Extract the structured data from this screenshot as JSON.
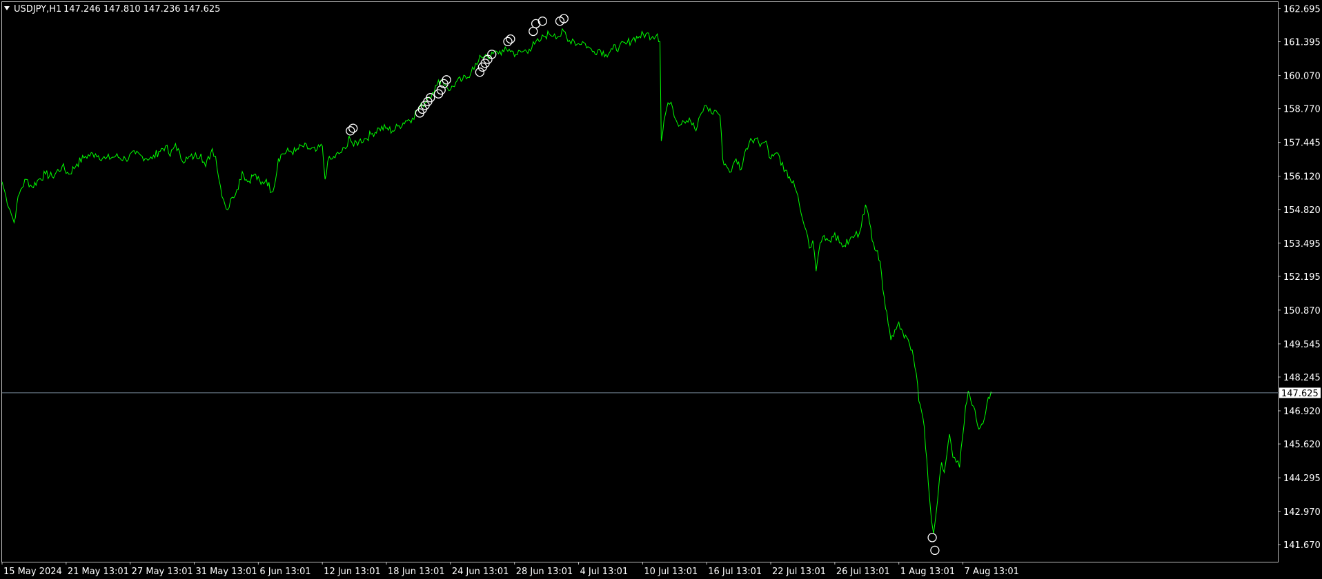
{
  "header": {
    "menu_icon": "triangle-down-icon",
    "symbol": "USDJPY,H1",
    "ohlc": "147.246 147.810 147.236 147.625"
  },
  "colors": {
    "background": "#000000",
    "price_line": "#00ff00",
    "frame": "#c0c0c0",
    "bid_line": "#778899",
    "marker": "#ffffff",
    "text": "#ffffff"
  },
  "current_price": {
    "value": 147.625,
    "label": "147.625"
  },
  "chart_data": {
    "type": "line",
    "title": "USDJPY,H1",
    "ylim": [
      141.0,
      162.95
    ],
    "grid": false,
    "y_ticks": [
      "162.695",
      "161.395",
      "160.070",
      "158.770",
      "157.445",
      "156.120",
      "154.820",
      "153.495",
      "152.195",
      "150.870",
      "149.545",
      "148.245",
      "146.920",
      "145.620",
      "144.295",
      "142.970",
      "141.670"
    ],
    "x_ticks": [
      "15 May 2024",
      "21 May 13:01",
      "27 May 13:01",
      "31 May 13:01",
      "6 Jun 13:01",
      "12 Jun 13:01",
      "18 Jun 13:01",
      "24 Jun 13:01",
      "28 Jun 13:01",
      "4 Jul 13:01",
      "10 Jul 13:01",
      "16 Jul 13:01",
      "22 Jul 13:01",
      "26 Jul 13:01",
      "1 Aug 13:01",
      "7 Aug 13:01"
    ],
    "x_tick_bars": [
      0,
      96,
      192,
      288,
      384,
      480,
      576,
      672,
      768,
      864,
      960,
      1056,
      1152,
      1248,
      1344,
      1440
    ],
    "x_range_bars": [
      0,
      1912
    ],
    "series": [
      {
        "values": [
          [
            0,
            155.9
          ],
          [
            6,
            155.3
          ],
          [
            12,
            154.8
          ],
          [
            18,
            154.3
          ],
          [
            22,
            155.0
          ],
          [
            28,
            155.6
          ],
          [
            36,
            156.0
          ],
          [
            45,
            155.7
          ],
          [
            55,
            156.0
          ],
          [
            65,
            156.2
          ],
          [
            75,
            156.1
          ],
          [
            90,
            156.5
          ],
          [
            100,
            156.2
          ],
          [
            112,
            156.6
          ],
          [
            125,
            156.9
          ],
          [
            140,
            157.0
          ],
          [
            155,
            156.8
          ],
          [
            170,
            156.9
          ],
          [
            185,
            156.8
          ],
          [
            200,
            157.0
          ],
          [
            210,
            156.9
          ],
          [
            225,
            156.8
          ],
          [
            235,
            157.1
          ],
          [
            245,
            157.3
          ],
          [
            252,
            156.9
          ],
          [
            260,
            157.4
          ],
          [
            268,
            156.8
          ],
          [
            278,
            156.8
          ],
          [
            288,
            156.9
          ],
          [
            298,
            157.0
          ],
          [
            305,
            156.5
          ],
          [
            315,
            157.2
          ],
          [
            320,
            156.9
          ],
          [
            325,
            156.0
          ],
          [
            332,
            155.2
          ],
          [
            338,
            154.8
          ],
          [
            345,
            155.3
          ],
          [
            352,
            155.6
          ],
          [
            360,
            156.3
          ],
          [
            368,
            155.9
          ],
          [
            378,
            156.2
          ],
          [
            388,
            155.8
          ],
          [
            396,
            156.0
          ],
          [
            404,
            155.5
          ],
          [
            410,
            156.0
          ],
          [
            414,
            156.8
          ],
          [
            420,
            157.0
          ],
          [
            430,
            157.1
          ],
          [
            440,
            157.1
          ],
          [
            450,
            157.3
          ],
          [
            460,
            157.2
          ],
          [
            470,
            157.1
          ],
          [
            480,
            157.3
          ],
          [
            484,
            156.0
          ],
          [
            488,
            156.7
          ],
          [
            495,
            156.8
          ],
          [
            505,
            157.0
          ],
          [
            515,
            157.2
          ],
          [
            520,
            157.7
          ],
          [
            527,
            157.3
          ],
          [
            535,
            157.5
          ],
          [
            545,
            157.6
          ],
          [
            555,
            157.8
          ],
          [
            565,
            158.0
          ],
          [
            575,
            158.0
          ],
          [
            585,
            157.9
          ],
          [
            595,
            158.1
          ],
          [
            605,
            158.3
          ],
          [
            615,
            158.4
          ],
          [
            622,
            158.7
          ],
          [
            630,
            158.9
          ],
          [
            638,
            159.2
          ],
          [
            645,
            159.4
          ],
          [
            652,
            159.7
          ],
          [
            658,
            159.9
          ],
          [
            665,
            159.7
          ],
          [
            672,
            159.5
          ],
          [
            680,
            159.8
          ],
          [
            690,
            159.9
          ],
          [
            698,
            160.0
          ],
          [
            705,
            160.4
          ],
          [
            712,
            160.5
          ],
          [
            718,
            160.8
          ],
          [
            725,
            160.9
          ],
          [
            732,
            160.8
          ],
          [
            742,
            161.0
          ],
          [
            752,
            161.0
          ],
          [
            760,
            161.1
          ],
          [
            770,
            160.9
          ],
          [
            780,
            161.0
          ],
          [
            790,
            161.1
          ],
          [
            798,
            161.3
          ],
          [
            805,
            161.4
          ],
          [
            812,
            161.6
          ],
          [
            820,
            161.7
          ],
          [
            828,
            161.7
          ],
          [
            835,
            161.6
          ],
          [
            842,
            161.8
          ],
          [
            848,
            161.4
          ],
          [
            855,
            161.5
          ],
          [
            862,
            161.3
          ],
          [
            870,
            161.4
          ],
          [
            878,
            161.2
          ],
          [
            885,
            161.0
          ],
          [
            895,
            161.1
          ],
          [
            905,
            160.9
          ],
          [
            915,
            161.1
          ],
          [
            925,
            161.2
          ],
          [
            935,
            161.3
          ],
          [
            945,
            161.5
          ],
          [
            955,
            161.6
          ],
          [
            965,
            161.7
          ],
          [
            975,
            161.6
          ],
          [
            982,
            161.7
          ],
          [
            986,
            161.4
          ],
          [
            988,
            157.5
          ],
          [
            992,
            158.3
          ],
          [
            998,
            159.0
          ],
          [
            1005,
            158.8
          ],
          [
            1012,
            158.2
          ],
          [
            1020,
            158.3
          ],
          [
            1030,
            158.4
          ],
          [
            1040,
            157.9
          ],
          [
            1048,
            158.6
          ],
          [
            1055,
            158.9
          ],
          [
            1063,
            158.6
          ],
          [
            1070,
            158.7
          ],
          [
            1076,
            158.5
          ],
          [
            1080,
            156.8
          ],
          [
            1086,
            156.5
          ],
          [
            1093,
            156.3
          ],
          [
            1100,
            156.8
          ],
          [
            1108,
            156.4
          ],
          [
            1115,
            157.2
          ],
          [
            1122,
            157.6
          ],
          [
            1130,
            157.6
          ],
          [
            1138,
            157.4
          ],
          [
            1145,
            157.5
          ],
          [
            1152,
            156.8
          ],
          [
            1158,
            157.0
          ],
          [
            1165,
            156.9
          ],
          [
            1172,
            156.3
          ],
          [
            1180,
            156.1
          ],
          [
            1188,
            155.7
          ],
          [
            1195,
            155.0
          ],
          [
            1200,
            154.4
          ],
          [
            1205,
            154.0
          ],
          [
            1210,
            153.3
          ],
          [
            1215,
            153.6
          ],
          [
            1220,
            152.4
          ],
          [
            1226,
            153.5
          ],
          [
            1232,
            153.8
          ],
          [
            1240,
            153.6
          ],
          [
            1248,
            153.9
          ],
          [
            1255,
            153.5
          ],
          [
            1262,
            153.4
          ],
          [
            1270,
            153.6
          ],
          [
            1278,
            153.8
          ],
          [
            1285,
            153.9
          ],
          [
            1290,
            154.6
          ],
          [
            1294,
            155.0
          ],
          [
            1300,
            154.3
          ],
          [
            1306,
            153.5
          ],
          [
            1312,
            153.2
          ],
          [
            1318,
            152.3
          ],
          [
            1322,
            151.4
          ],
          [
            1326,
            150.8
          ],
          [
            1332,
            149.7
          ],
          [
            1338,
            150.1
          ],
          [
            1344,
            150.4
          ],
          [
            1350,
            150.0
          ],
          [
            1356,
            149.8
          ],
          [
            1362,
            149.3
          ],
          [
            1366,
            149.0
          ],
          [
            1370,
            148.4
          ],
          [
            1374,
            147.3
          ],
          [
            1378,
            146.9
          ],
          [
            1382,
            146.3
          ],
          [
            1386,
            145.0
          ],
          [
            1390,
            143.5
          ],
          [
            1393,
            142.6
          ],
          [
            1396,
            142.1
          ],
          [
            1399,
            142.7
          ],
          [
            1402,
            143.4
          ],
          [
            1405,
            144.3
          ],
          [
            1408,
            144.9
          ],
          [
            1412,
            144.5
          ],
          [
            1416,
            145.2
          ],
          [
            1420,
            146.0
          ],
          [
            1425,
            145.1
          ],
          [
            1430,
            144.9
          ],
          [
            1435,
            144.7
          ],
          [
            1440,
            146.0
          ],
          [
            1444,
            147.1
          ],
          [
            1448,
            147.7
          ],
          [
            1452,
            147.3
          ],
          [
            1456,
            147.1
          ],
          [
            1460,
            146.6
          ],
          [
            1464,
            146.2
          ],
          [
            1468,
            146.4
          ],
          [
            1472,
            146.6
          ],
          [
            1476,
            147.2
          ],
          [
            1480,
            147.4
          ],
          [
            1484,
            147.6
          ]
        ]
      }
    ],
    "markers": [
      [
        522,
        157.9
      ],
      [
        526,
        158.0
      ],
      [
        626,
        158.6
      ],
      [
        630,
        158.75
      ],
      [
        634,
        158.9
      ],
      [
        638,
        159.05
      ],
      [
        642,
        159.2
      ],
      [
        654,
        159.35
      ],
      [
        658,
        159.5
      ],
      [
        662,
        159.75
      ],
      [
        666,
        159.9
      ],
      [
        716,
        160.2
      ],
      [
        720,
        160.4
      ],
      [
        724,
        160.55
      ],
      [
        728,
        160.7
      ],
      [
        734,
        160.9
      ],
      [
        758,
        161.4
      ],
      [
        762,
        161.5
      ],
      [
        796,
        161.8
      ],
      [
        800,
        162.1
      ],
      [
        810,
        162.2
      ],
      [
        836,
        162.2
      ],
      [
        842,
        162.3
      ],
      [
        1394,
        141.95
      ],
      [
        1398,
        141.45
      ]
    ]
  }
}
